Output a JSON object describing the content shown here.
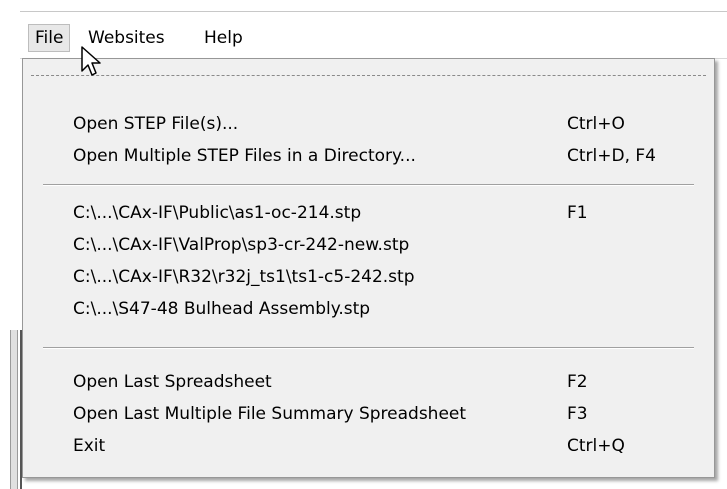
{
  "menubar": {
    "items": [
      {
        "label": "File"
      },
      {
        "label": "Websites"
      },
      {
        "label": "Help"
      }
    ]
  },
  "file_menu": {
    "items": [
      {
        "label": "Open STEP File(s)...",
        "accel": "Ctrl+O"
      },
      {
        "label": "Open Multiple STEP Files in a Directory...",
        "accel": "Ctrl+D, F4"
      },
      {
        "label": "C:\\...\\CAx-IF\\Public\\as1-oc-214.stp",
        "accel": "F1"
      },
      {
        "label": "C:\\...\\CAx-IF\\ValProp\\sp3-cr-242-new.stp",
        "accel": ""
      },
      {
        "label": "C:\\...\\CAx-IF\\R32\\r32j_ts1\\ts1-c5-242.stp",
        "accel": ""
      },
      {
        "label": "C:\\...\\S47-48 Bulhead Assembly.stp",
        "accel": ""
      },
      {
        "label": "Open Last Spreadsheet",
        "accel": "F2"
      },
      {
        "label": "Open Last Multiple File Summary Spreadsheet",
        "accel": "F3"
      },
      {
        "label": "Exit",
        "accel": "Ctrl+Q"
      }
    ]
  },
  "icons": {
    "cursor": "arrow-pointer-icon"
  },
  "colors": {
    "menu_bg": "#f0f0f0",
    "menubar_bg": "#ffffff",
    "active_item_bg": "#e8e8e8"
  }
}
